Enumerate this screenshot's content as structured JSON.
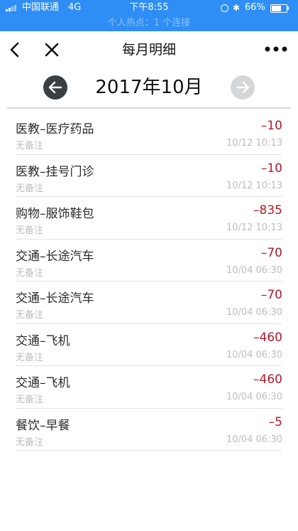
{
  "status_bar": {
    "carrier": "中国联通",
    "network": "4G",
    "time": "下午8:55",
    "battery": "66%",
    "battery_level": 0.66,
    "hotspot": "个人热点：1 个连接"
  },
  "nav": {
    "title": "每月明细"
  },
  "month": {
    "label": "2017年10月"
  },
  "colors": {
    "status_bar_bg": "#2f8ef5",
    "amount": "#b01a2a",
    "prev_button": "#3a3f44",
    "next_button": "#d4d6d8"
  },
  "transactions": [
    {
      "category": "医教–医疗药品",
      "note": "无备注",
      "amount": "–10",
      "time": "10/12 10:13"
    },
    {
      "category": "医教–挂号门诊",
      "note": "无备注",
      "amount": "–10",
      "time": "10/12 10:13"
    },
    {
      "category": "购物–服饰鞋包",
      "note": "无备注",
      "amount": "–835",
      "time": "10/12 10:13"
    },
    {
      "category": "交通–长途汽车",
      "note": "无备注",
      "amount": "–70",
      "time": "10/04 06:30"
    },
    {
      "category": "交通–长途汽车",
      "note": "无备注",
      "amount": "–70",
      "time": "10/04 06:30"
    },
    {
      "category": "交通–飞机",
      "note": "无备注",
      "amount": "–460",
      "time": "10/04 06:30"
    },
    {
      "category": "交通–飞机",
      "note": "无备注",
      "amount": "–460",
      "time": "10/04 06:30"
    },
    {
      "category": "餐饮–早餐",
      "note": "无备注",
      "amount": "–5",
      "time": "10/04 06:30"
    }
  ]
}
